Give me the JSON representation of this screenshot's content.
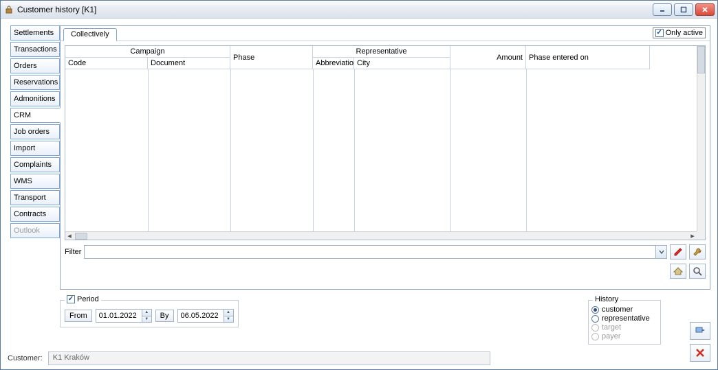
{
  "window": {
    "title": "Customer history [K1]"
  },
  "sidebar": {
    "items": [
      {
        "label": "Settlements"
      },
      {
        "label": "Transactions"
      },
      {
        "label": "Orders"
      },
      {
        "label": "Reservations"
      },
      {
        "label": "Admonitions"
      },
      {
        "label": "CRM"
      },
      {
        "label": "Job orders"
      },
      {
        "label": "Import"
      },
      {
        "label": "Complaints"
      },
      {
        "label": "WMS"
      },
      {
        "label": "Transport"
      },
      {
        "label": "Contracts"
      },
      {
        "label": "Outlook"
      }
    ],
    "active_index": 5,
    "disabled_index": 12
  },
  "tabs": {
    "top": [
      {
        "label": "Collectively"
      }
    ],
    "active_index": 0
  },
  "only_active": {
    "label": "Only active",
    "checked": true
  },
  "grid": {
    "groups": {
      "campaign": "Campaign",
      "representative": "Representative"
    },
    "columns": {
      "code": "Code",
      "document": "Document",
      "phase": "Phase",
      "abbreviation": "Abbreviation",
      "city": "City",
      "amount": "Amount",
      "phase_entered_on": "Phase entered on"
    }
  },
  "filter": {
    "label": "Filter",
    "value": ""
  },
  "period": {
    "legend": "Period",
    "checked": true,
    "from_label": "From",
    "by_label": "By",
    "from_value": "01.01.2022",
    "by_value": "06.05.2022"
  },
  "history": {
    "legend": "History",
    "options": [
      {
        "label": "customer",
        "selected": true,
        "disabled": false
      },
      {
        "label": "representative",
        "selected": false,
        "disabled": false
      },
      {
        "label": "target",
        "selected": false,
        "disabled": true
      },
      {
        "label": "payer",
        "selected": false,
        "disabled": true
      }
    ]
  },
  "customer": {
    "label": "Customer:",
    "value": "K1 Kraków"
  }
}
